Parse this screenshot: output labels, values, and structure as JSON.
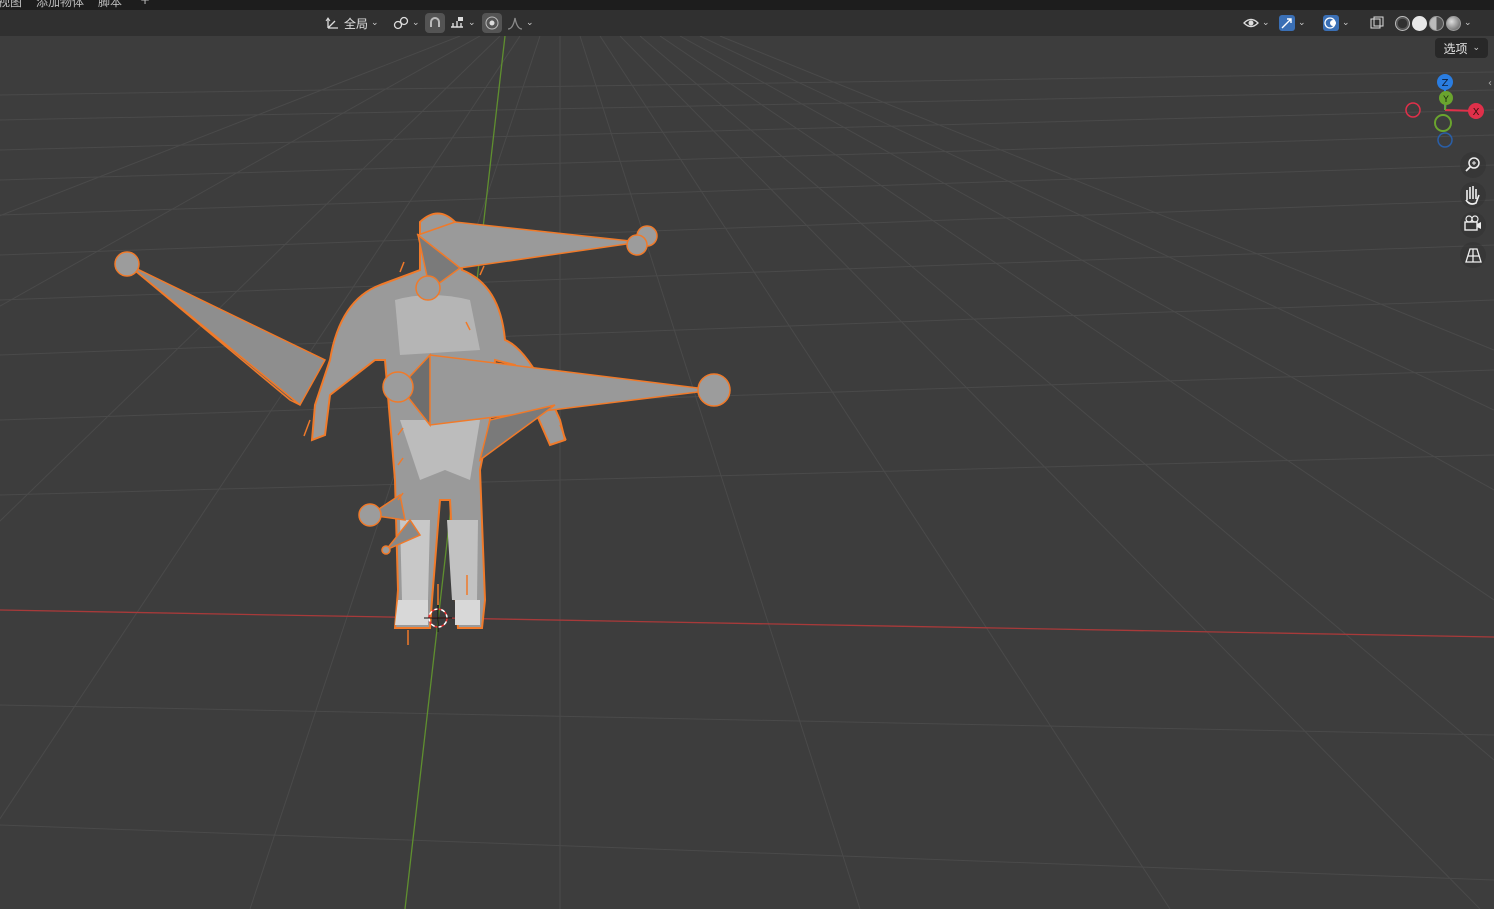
{
  "menubar": {
    "items": [
      "视图",
      "添加物体",
      "脚本",
      "+"
    ]
  },
  "header": {
    "transform_orientation": "全局",
    "options_label": "选项"
  },
  "gizmo": {
    "x_label": "X",
    "y_label": "Y",
    "z_label": "Z",
    "colors": {
      "x": "#e0304a",
      "y": "#6aa42e",
      "z": "#2a7de1"
    }
  },
  "nav_tools": [
    "zoom-icon",
    "pan-hand-icon",
    "camera-icon",
    "grid-perspective-icon"
  ],
  "theme": {
    "viewport_bg": "#3d3d3d",
    "selection_outline": "#f07a2a",
    "x_axis": "#b53a3a",
    "y_axis": "#6a9a35"
  }
}
